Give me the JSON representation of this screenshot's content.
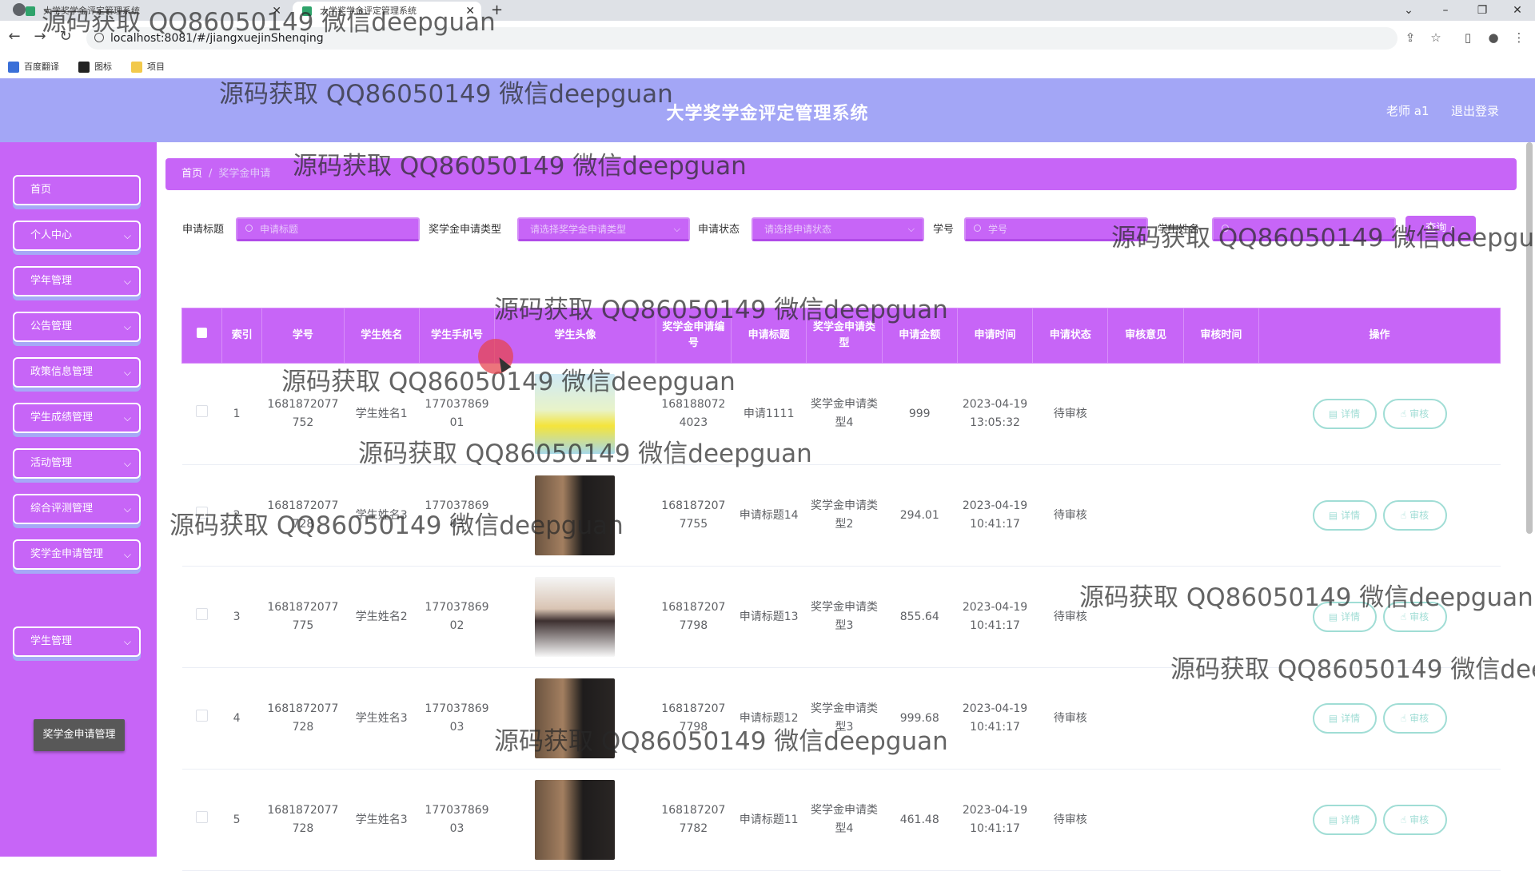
{
  "browser": {
    "tabs": [
      {
        "title": "大学奖学金评定管理系统"
      },
      {
        "title": "大学奖学金评定管理系统"
      }
    ],
    "url": "localhost:8081/#/jiangxuejinShenqing",
    "bookmarks": [
      "百度翻译",
      "图标",
      "项目"
    ]
  },
  "header": {
    "title": "大学奖学金评定管理系统",
    "user": "老师 a1",
    "logout": "退出登录"
  },
  "sidebar": {
    "items": [
      {
        "label": "首页"
      },
      {
        "label": "个人中心"
      },
      {
        "label": "学年管理"
      },
      {
        "label": "公告管理"
      },
      {
        "label": "政策信息管理"
      },
      {
        "label": "学生成绩管理"
      },
      {
        "label": "活动管理"
      },
      {
        "label": "综合评测管理"
      },
      {
        "label": "奖学金申请管理"
      },
      {
        "label": "学生管理"
      }
    ],
    "active_sub": "奖学金申请管理"
  },
  "breadcrumb": {
    "home": "首页",
    "current": "奖学金申请"
  },
  "filters": {
    "title_label": "申请标题",
    "title_placeholder": "申请标题",
    "type_label": "奖学金申请类型",
    "type_placeholder": "请选择奖学金申请类型",
    "status_label": "申请状态",
    "status_placeholder": "请选择申请状态",
    "xuehao_label": "学号",
    "xuehao_placeholder": "学号",
    "name_label": "学生姓名",
    "search_button": "查询"
  },
  "table": {
    "columns": [
      "索引",
      "学号",
      "学生姓名",
      "学生手机号",
      "学生头像",
      "奖学金申请编号",
      "申请标题",
      "奖学金申请类型",
      "申请金额",
      "申请时间",
      "申请状态",
      "审核意见",
      "审核时间",
      "操作"
    ],
    "detail_label": "详情",
    "audit_label": "审核",
    "rows": [
      {
        "index": "1",
        "xuehao": "1681872077752",
        "name": "学生姓名1",
        "phone": "17703786901",
        "avatar": "photo-woman",
        "apply_no": "1681880724023",
        "title": "申请1111",
        "type": "奖学金申请类型4",
        "amount": "999",
        "time": "2023-04-19 13:05:32",
        "status": "待审核",
        "opinion": "",
        "audit_time": ""
      },
      {
        "index": "2",
        "xuehao": "1681872077728",
        "name": "学生姓名3",
        "phone": "17703786903",
        "avatar": "photo-man-back",
        "apply_no": "1681872077755",
        "title": "申请标题14",
        "type": "奖学金申请类型2",
        "amount": "294.01",
        "time": "2023-04-19 10:41:17",
        "status": "待审核",
        "opinion": "",
        "audit_time": ""
      },
      {
        "index": "3",
        "xuehao": "1681872077775",
        "name": "学生姓名2",
        "phone": "17703786902",
        "avatar": "photo-man-front",
        "apply_no": "1681872077798",
        "title": "申请标题13",
        "type": "奖学金申请类型3",
        "amount": "855.64",
        "time": "2023-04-19 10:41:17",
        "status": "待审核",
        "opinion": "",
        "audit_time": ""
      },
      {
        "index": "4",
        "xuehao": "1681872077728",
        "name": "学生姓名3",
        "phone": "17703786903",
        "avatar": "photo-man-back",
        "apply_no": "1681872077798",
        "title": "申请标题12",
        "type": "奖学金申请类型3",
        "amount": "999.68",
        "time": "2023-04-19 10:41:17",
        "status": "待审核",
        "opinion": "",
        "audit_time": ""
      },
      {
        "index": "5",
        "xuehao": "1681872077728",
        "name": "学生姓名3",
        "phone": "17703786903",
        "avatar": "photo-man-back",
        "apply_no": "1681872077782",
        "title": "申请标题11",
        "type": "奖学金申请类型4",
        "amount": "461.48",
        "time": "2023-04-19 10:41:17",
        "status": "待审核",
        "opinion": "",
        "audit_time": ""
      }
    ]
  },
  "watermark": "源码获取 QQ86050149 微信deepguan",
  "colors": {
    "primary": "#c765f7",
    "header": "#a3a6f6",
    "button_outline": "#a0ddd5"
  }
}
